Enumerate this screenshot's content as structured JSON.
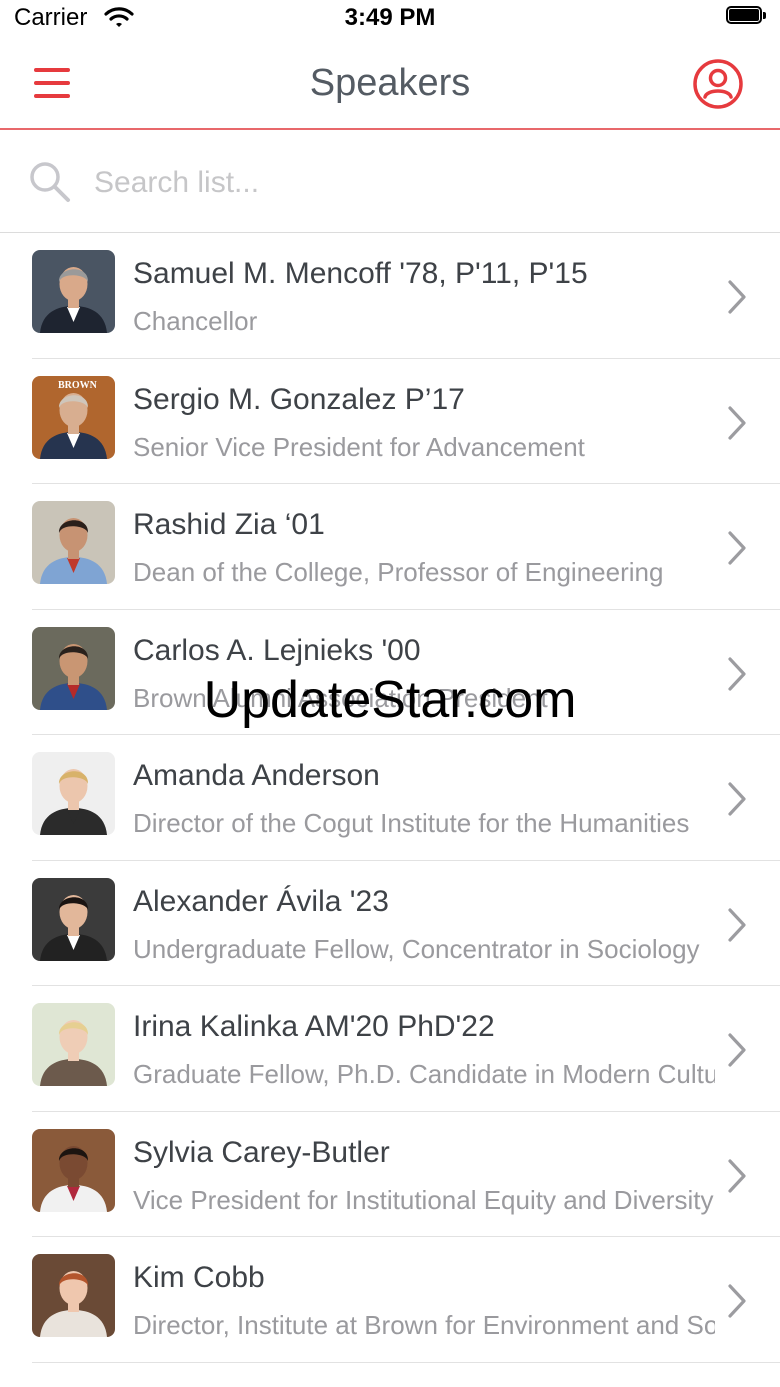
{
  "status_bar": {
    "carrier": "Carrier",
    "time": "3:49 PM"
  },
  "nav": {
    "title": "Speakers"
  },
  "search": {
    "placeholder": "Search list..."
  },
  "speakers": [
    {
      "name": "Samuel M. Mencoff '78, P'11, P'15",
      "title": "Chancellor",
      "photo": {
        "bg": "#4a5563",
        "skin": "#d9a98a",
        "hair": "#9a9a9a",
        "suit": "#1e2430",
        "shirt": "#ffffff"
      }
    },
    {
      "name": "Sergio M. Gonzalez P’17",
      "title": "Senior Vice President for Advancement",
      "photo": {
        "bg": "#b0662e",
        "skin": "#d8ae90",
        "hair": "#cfc6bb",
        "suit": "#26344f",
        "shirt": "#ffffff",
        "label": "BROWN"
      }
    },
    {
      "name": "Rashid Zia ‘01",
      "title": "Dean of the College, Professor of Engineering",
      "photo": {
        "bg": "#c9c4b8",
        "skin": "#c79373",
        "hair": "#2a1f1a",
        "suit": "#7fa4d3",
        "shirt": "#c0392b"
      }
    },
    {
      "name": "Carlos A. Lejnieks '00",
      "title": "Brown Alumni Association President",
      "photo": {
        "bg": "#6b6a5d",
        "skin": "#c99673",
        "hair": "#2a211c",
        "suit": "#2f4f8a",
        "shirt": "#b52a2a"
      }
    },
    {
      "name": "Amanda Anderson",
      "title": "Director of the Cogut Institute for the Humanities",
      "photo": {
        "bg": "#efefef",
        "skin": "#ecc6ad",
        "hair": "#d8b26a",
        "suit": "#2b2b2b",
        "shirt": "#2b2b2b"
      }
    },
    {
      "name": "Alexander Ávila '23",
      "title": "Undergraduate Fellow, Concentrator in Sociology",
      "photo": {
        "bg": "#3b3b3b",
        "skin": "#e2b79a",
        "hair": "#1a1412",
        "suit": "#222222",
        "shirt": "#ffffff"
      }
    },
    {
      "name": "Irina Kalinka AM'20 PhD'22",
      "title": "Graduate Fellow, Ph.D. Candidate in Modern Culture",
      "photo": {
        "bg": "#dfe6d4",
        "skin": "#efcdb6",
        "hair": "#e6cf91",
        "suit": "#6c5a4c",
        "shirt": "#6c5a4c"
      }
    },
    {
      "name": "Sylvia Carey-Butler",
      "title": "Vice President for Institutional Equity and Diversity",
      "photo": {
        "bg": "#8a5a3a",
        "skin": "#7a4a32",
        "hair": "#1c1410",
        "suit": "#f1f1f1",
        "shirt": "#b1283d"
      }
    },
    {
      "name": "Kim Cobb",
      "title": "Director, Institute at Brown for Environment and Society",
      "photo": {
        "bg": "#6a4a36",
        "skin": "#efc7ae",
        "hair": "#b4552c",
        "suit": "#e9e3dc",
        "shirt": "#e9e3dc"
      }
    }
  ],
  "watermark": "UpdateStar.com",
  "colors": {
    "accent": "#e63a3e",
    "divider": "#e8686b"
  },
  "icons": {
    "menu": "hamburger-icon",
    "profile": "user-circle-icon",
    "search": "search-icon",
    "chevron": "chevron-right-icon"
  }
}
